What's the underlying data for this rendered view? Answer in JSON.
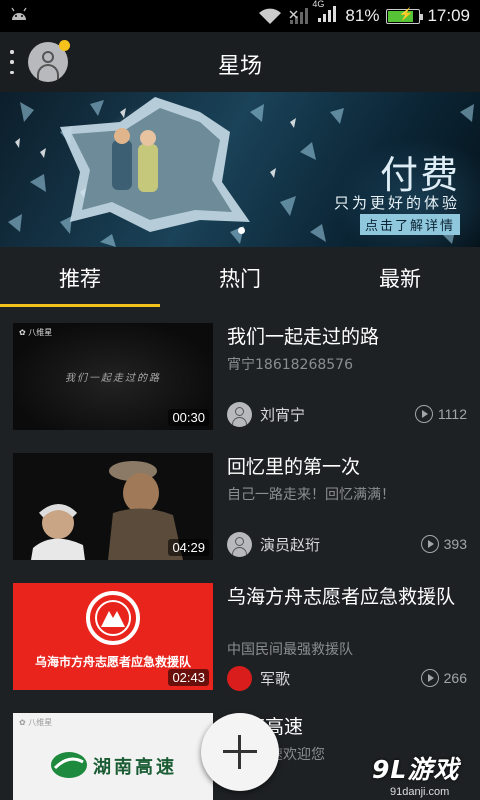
{
  "status_bar": {
    "network": "4G",
    "battery_percent": "81%",
    "battery_level": 0.81,
    "time": "17:09"
  },
  "header": {
    "title": "星场"
  },
  "banner": {
    "title": "付费",
    "subtitle": "只为更好的体验",
    "cta": "点击了解详情"
  },
  "tabs": [
    {
      "label": "推荐",
      "active": true
    },
    {
      "label": "热门",
      "active": false
    },
    {
      "label": "最新",
      "active": false
    }
  ],
  "videos": [
    {
      "title": "我们一起走过的路",
      "subtitle": "宵宁18618268576",
      "uploader": "刘宵宁",
      "plays": "1112",
      "duration": "00:30",
      "thumb_logo": "八维星",
      "thumb_caption": "我们一起走过的路"
    },
    {
      "title": "回忆里的第一次",
      "subtitle": "自己一路走来！回忆满满！",
      "uploader": "演员赵珩",
      "plays": "393",
      "duration": "04:29"
    },
    {
      "title": "乌海方舟志愿者应急救援队",
      "subtitle": "中国民间最强救援队",
      "uploader": "军歌",
      "plays": "266",
      "duration": "02:43",
      "thumb_caption": "乌海市方舟志愿者应急救援队"
    },
    {
      "title": "湖南高速",
      "subtitle": "湖南高速欢迎您",
      "thumb_logo": "八维星",
      "thumb_caption": "湖南高速"
    }
  ],
  "watermark": {
    "brand": "9L游戏",
    "url": "91danji.com"
  }
}
